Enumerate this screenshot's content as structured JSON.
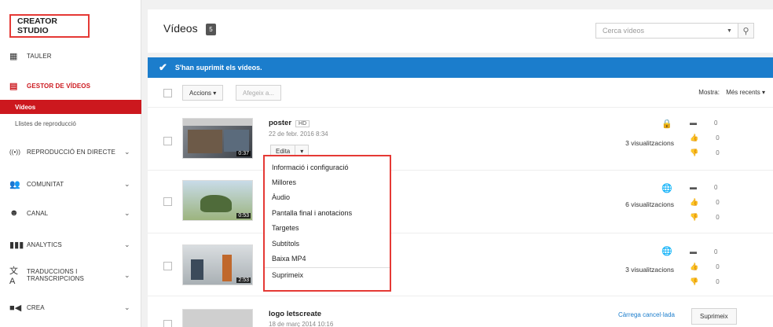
{
  "sidebar": {
    "brand": "CREATOR STUDIO",
    "items": [
      {
        "label": "TAULER",
        "icon": "dashboard-icon"
      },
      {
        "label": "GESTOR DE VÍDEOS",
        "icon": "video-manager-icon"
      },
      {
        "label": "REPRODUCCIÓ EN DIRECTE",
        "icon": "live-icon"
      },
      {
        "label": "COMUNITAT",
        "icon": "community-icon"
      },
      {
        "label": "CANAL",
        "icon": "channel-icon"
      },
      {
        "label": "ANALYTICS",
        "icon": "analytics-icon"
      },
      {
        "label": "TRADUCCIONS I TRANSCRIPCIONS",
        "icon": "translate-icon"
      },
      {
        "label": "CREA",
        "icon": "camera-icon"
      }
    ],
    "sub": {
      "active": "Vídeos",
      "other": "Llistes de reproducció"
    },
    "accent": "#cc181e"
  },
  "header": {
    "title": "Vídeos",
    "count": "5",
    "search_placeholder": "Cerca vídeos"
  },
  "notice": {
    "text": "S'han suprimit els vídeos.",
    "color": "#1b7dcc"
  },
  "toolbar": {
    "actions": "Accions ▾",
    "add_to": "Afegeix a...",
    "show_label": "Mostra:",
    "sort": "Més recents ▾"
  },
  "videos": [
    {
      "title": "poster",
      "badge": "HD",
      "date": "22 de febr. 2016 8:34",
      "duration": "0:37",
      "views": "3 visualitzacions",
      "privacy": "private",
      "comments": "0",
      "likes": "0",
      "dislikes": "0"
    },
    {
      "title": "",
      "date": "",
      "duration": "0:53",
      "views": "6 visualitzacions",
      "privacy": "public",
      "comments": "0",
      "likes": "0",
      "dislikes": "0"
    },
    {
      "title": "",
      "date": "",
      "duration": "2:53",
      "views": "3 visualitzacions",
      "privacy": "public",
      "comments": "0",
      "likes": "0",
      "dislikes": "0"
    },
    {
      "title": "logo letscreate",
      "date": "18 de març 2014 10:16",
      "status": "Càrrega cancel·lada",
      "delete": "Suprimeix"
    }
  ],
  "edit": {
    "label": "Edita",
    "arrow": "▾"
  },
  "menu": [
    "Informació i configuració",
    "Millores",
    "Àudio",
    "Pantalla final i anotacions",
    "Targetes",
    "Subtítols",
    "Baixa MP4",
    "Suprimeix"
  ]
}
